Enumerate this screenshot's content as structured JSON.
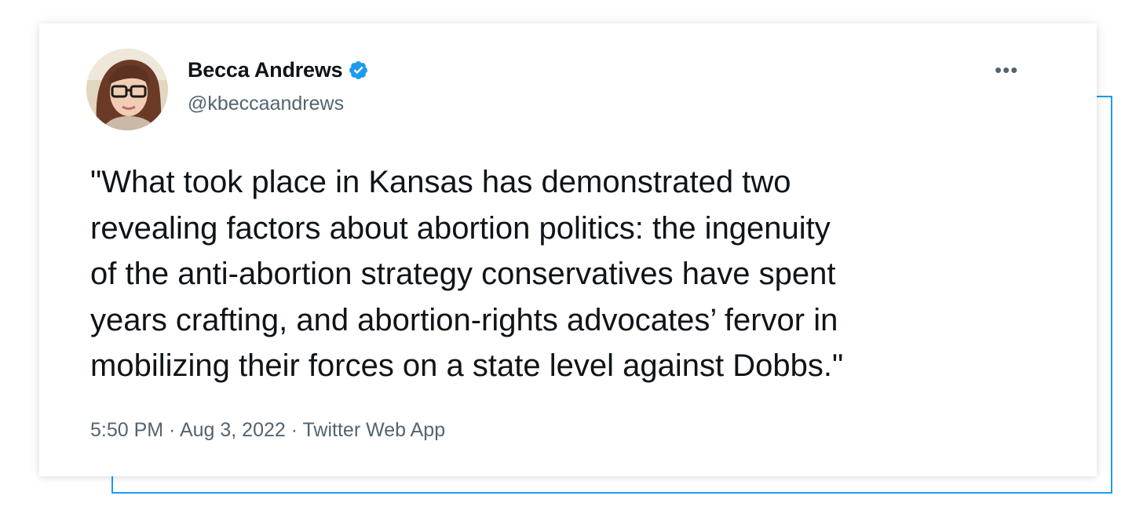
{
  "tweet": {
    "display_name": "Becca Andrews",
    "handle": "@kbeccaandrews",
    "verified": true,
    "more_label": "•••",
    "text": "\"What took place in Kansas has demonstrated two\nrevealing factors about abortion politics: the ingenuity\nof the anti-abortion strategy conservatives have spent\nyears crafting, and abortion-rights advocates’ fervor in\nmobilizing their forces on a state level against Dobbs.\"",
    "timestamp": "5:50 PM · Aug 3, 2022 · Twitter Web App"
  },
  "colors": {
    "accent": "#1d9bf0",
    "text_primary": "#0f1419",
    "text_secondary": "#536471"
  },
  "icons": {
    "verified": "verified-badge-icon",
    "more": "more-options-icon"
  }
}
